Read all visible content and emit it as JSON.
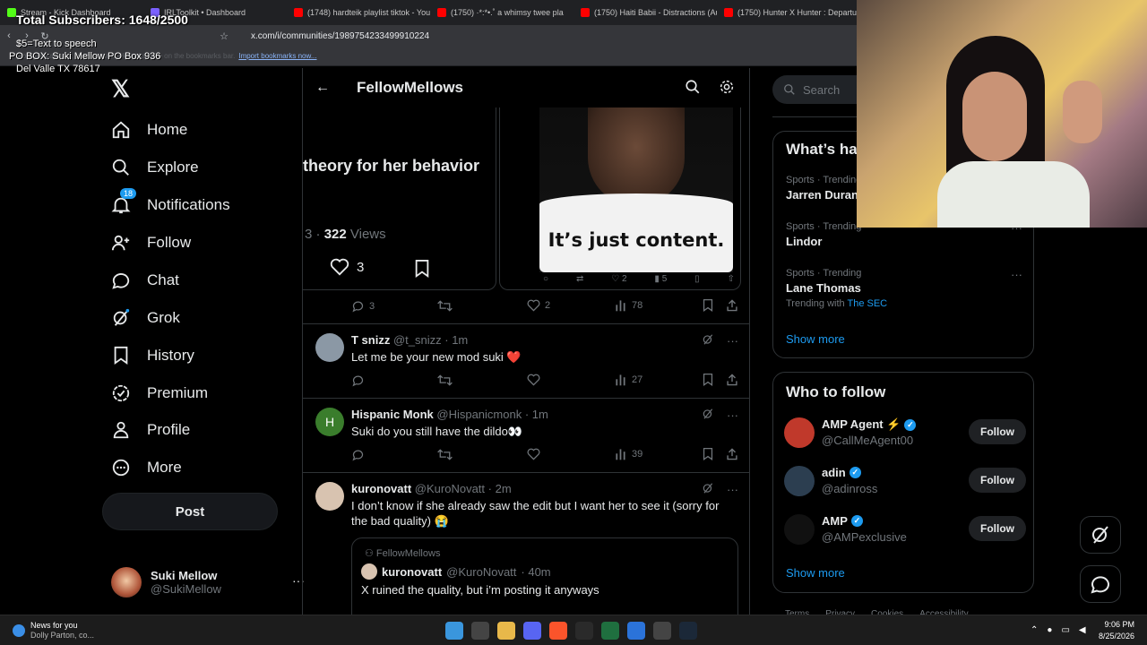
{
  "browser": {
    "tabs": [
      {
        "label": "Stream - Kick Dashboard",
        "color": "#53fc18"
      },
      {
        "label": "IRLToolkit • Dashboard",
        "color": "#7b61ff"
      },
      {
        "label": "(1748) hardteik playlist tiktok - You",
        "color": "#ff0000"
      },
      {
        "label": "(1750) ·*:*•.˚ a whimsy twee pla",
        "color": "#ff0000"
      },
      {
        "label": "(1750) Haiti Babii - Distractions (Au",
        "color": "#ff0000"
      },
      {
        "label": "(1750) Hunter X Hunter : Departure",
        "color": "#ff0000"
      }
    ],
    "url": "x.com/i/communities/1989754233499910224",
    "bookmark_notice": "For quick access, place your bookmarks here on the bookmarks bar.",
    "bookmark_link": "Import bookmarks now..."
  },
  "overlay": {
    "subscribers": "Total Subscribers: 1648/2500",
    "tts": "$5=Text to speech",
    "po_box": "PO BOX: Suki Mellow PO Box 936",
    "city": "Del Valle TX 78617"
  },
  "sidebar": {
    "logo": "𝕏",
    "items": [
      {
        "label": "Home",
        "icon": "home-icon"
      },
      {
        "label": "Explore",
        "icon": "search-icon"
      },
      {
        "label": "Notifications",
        "icon": "bell-icon",
        "badge": "18"
      },
      {
        "label": "Follow",
        "icon": "person-add-icon"
      },
      {
        "label": "Chat",
        "icon": "chat-icon"
      },
      {
        "label": "Grok",
        "icon": "grok-icon"
      },
      {
        "label": "History",
        "icon": "bookmark-icon"
      },
      {
        "label": "Premium",
        "icon": "verified-badge-icon"
      },
      {
        "label": "Profile",
        "icon": "person-icon"
      },
      {
        "label": "More",
        "icon": "more-circle-icon"
      }
    ],
    "post_label": "Post",
    "account": {
      "name": "Suki Mellow",
      "handle": "@SukiMellow",
      "more": "···"
    }
  },
  "community": {
    "title": "FellowMellows",
    "media_left": {
      "headline": "theory for her behavior",
      "views_prefix": "3 · ",
      "views_count": "322",
      "views_suffix": " Views",
      "likes": "3"
    },
    "media_right": {
      "caption": "It’s just content.",
      "replies": "",
      "likes": "2",
      "views": "5"
    },
    "first_actions": {
      "replies": "3",
      "likes": "2",
      "views": "78"
    },
    "tweets": [
      {
        "name": "T snizz",
        "handle": "@t_snizz",
        "time": "· 1m",
        "text": "Let me be your new mod suki ❤️",
        "replies": "",
        "likes": "",
        "views": "27",
        "avatar_color": "#8b98a5"
      },
      {
        "name": "Hispanic Monk",
        "handle": "@Hispanicmonk",
        "time": "· 1m",
        "text": "Suki do you still have the dildo👀",
        "replies": "",
        "likes": "",
        "views": "39",
        "avatar_color": "#3a7d2c",
        "initial": "H"
      },
      {
        "name": "kuronovatt",
        "handle": "@KuroNovatt",
        "time": "· 2m",
        "text": "I don’t know if she already saw the edit but I want her to see it (sorry for the bad quality) 😭",
        "avatar_color": "#d8c3b0"
      }
    ],
    "quote": {
      "community": "FellowMellows",
      "name": "kuronovatt",
      "handle": "@KuroNovatt",
      "time": "· 40m",
      "text": "X ruined the quality, but i’m posting it anyways"
    }
  },
  "right": {
    "search_placeholder": "Search",
    "trends_title": "What’s ha",
    "trends": [
      {
        "category": "Sports · Trending",
        "name": "Jarren Duran"
      },
      {
        "category": "Sports · Trending",
        "name": "Lindor"
      },
      {
        "category": "Sports · Trending",
        "name": "Lane Thomas",
        "with_prefix": "Trending with",
        "with_link": "The SEC"
      }
    ],
    "show_more": "Show more",
    "wtf_title": "Who to follow",
    "wtf": [
      {
        "name": "AMP Agent ⚡",
        "handle": "@CallMeAgent00",
        "button": "Follow",
        "avatar_color": "#c0392b"
      },
      {
        "name": "adin",
        "handle": "@adinross",
        "button": "Follow",
        "avatar_color": "#2c3e50"
      },
      {
        "name": "AMP",
        "handle": "@AMPexclusive",
        "button": "Follow",
        "avatar_color": "#111111"
      }
    ],
    "wtf_show_more": "Show more",
    "footer": [
      "Terms",
      "Privacy",
      "Cookies",
      "Accessibility"
    ]
  },
  "taskbar": {
    "news_title": "News for you",
    "news_sub": "Dolly Parton, co...",
    "time": "9:06 PM",
    "date": "8/25/2026",
    "apps": [
      "windows-icon",
      "search-icon",
      "file-explorer-icon",
      "discord-icon",
      "brave-icon",
      "epic-games-icon",
      "terminal-icon",
      "app-icon",
      "obs-icon",
      "steam-icon"
    ]
  }
}
